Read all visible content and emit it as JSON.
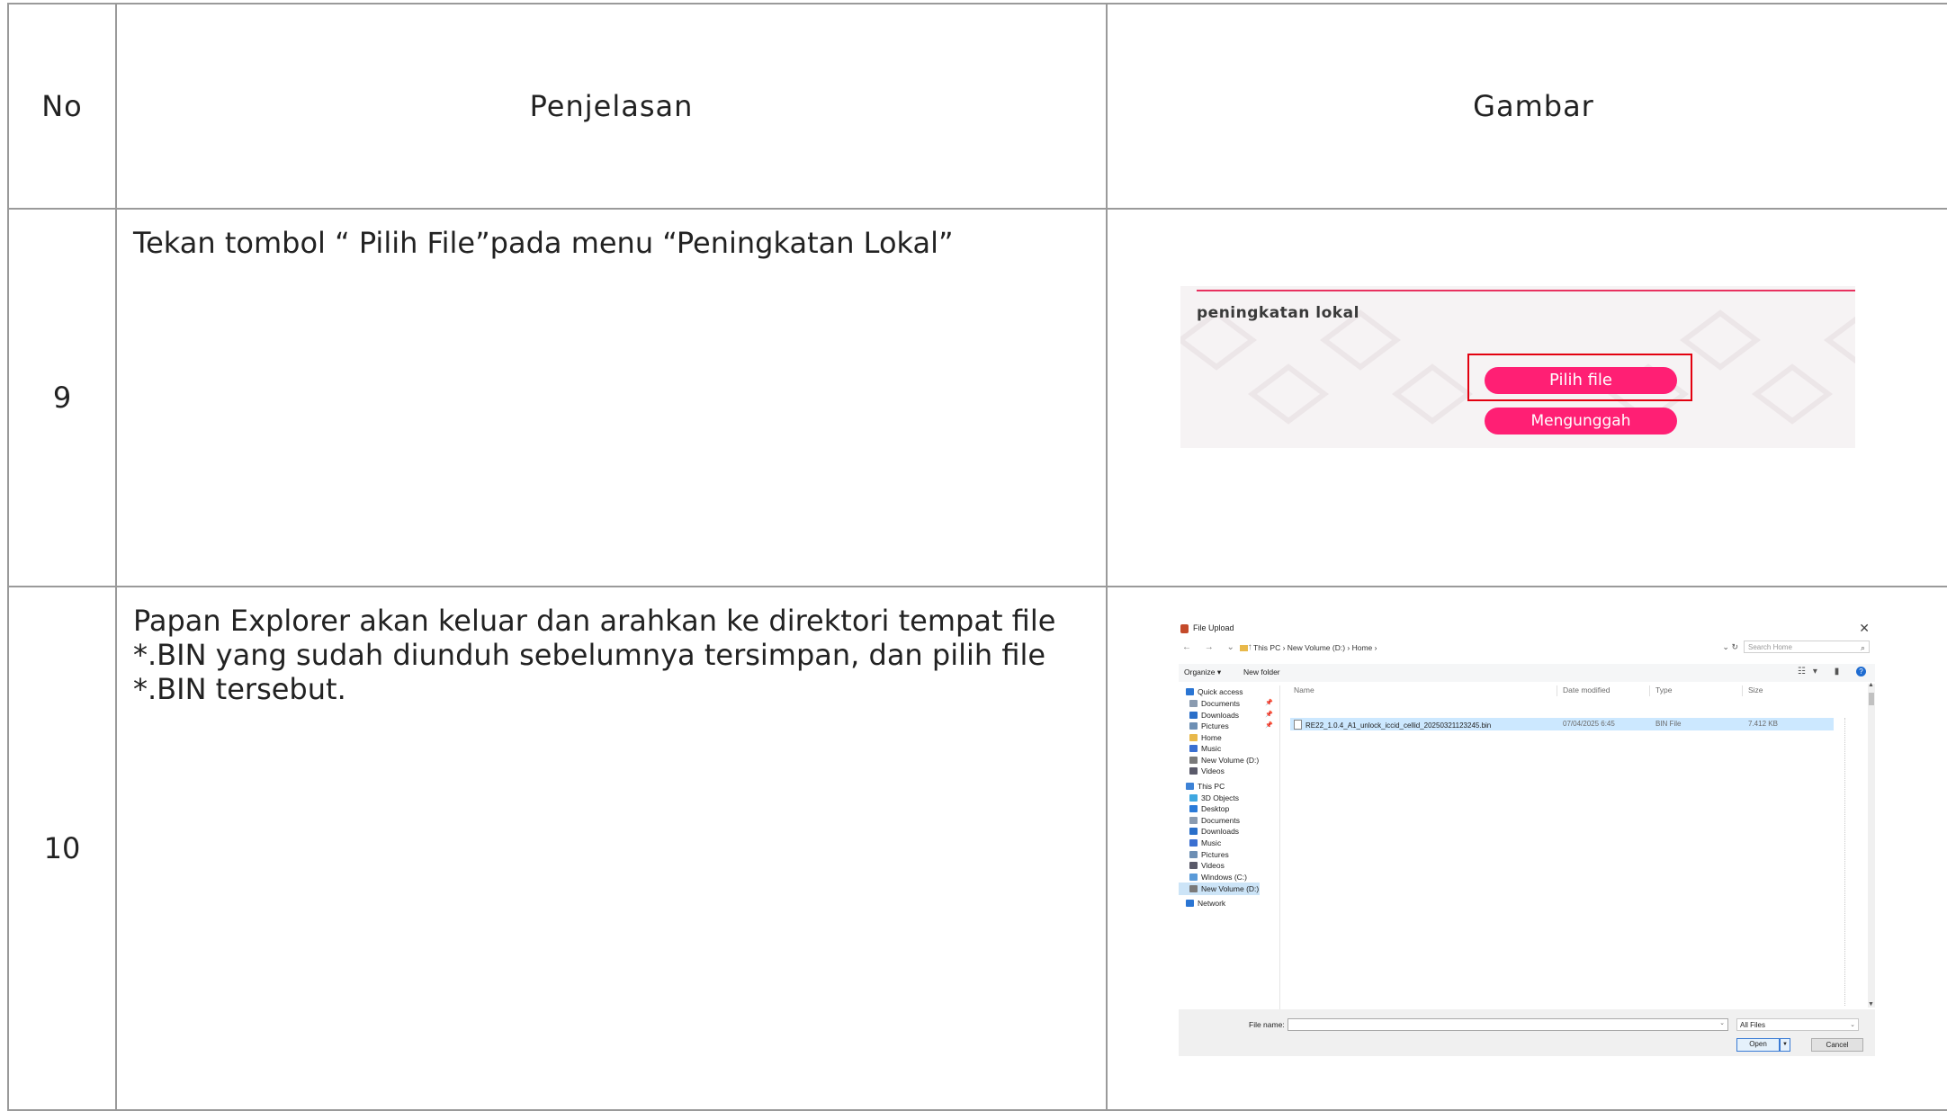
{
  "table": {
    "headers": {
      "no": "No",
      "penjelasan": "Penjelasan",
      "gambar": "Gambar"
    },
    "rows": [
      {
        "no": "9",
        "penjelasan": "Tekan tombol “ Pilih File”pada menu “Peningkatan Lokal”"
      },
      {
        "no": "10",
        "penjelasan": "Papan Explorer akan keluar dan arahkan ke direktori tempat file *.BIN yang sudah diunduh sebelumnya tersimpan, dan pilih file *.BIN tersebut."
      }
    ]
  },
  "shot_upgrade": {
    "title": "peningkatan lokal",
    "choose_file_label": "Pilih file",
    "upload_label": "Mengunggah",
    "accent": "#ff1f74",
    "highlight": "#e3000f"
  },
  "shot_dialog": {
    "title": "File Upload",
    "close": "✕",
    "nav_arrows": "← → ⌄ ↑",
    "breadcrumb": "This PC  ›  New Volume (D:)  ›  Home  ›",
    "search_placeholder": "Search Home",
    "organize": "Organize ▾",
    "new_folder": "New folder",
    "columns": {
      "name": "Name",
      "date": "Date modified",
      "type": "Type",
      "size": "Size"
    },
    "sidebar": [
      {
        "label": "Quick access",
        "icon": "star-icon",
        "color": "#2a75d3"
      },
      {
        "label": "Documents",
        "icon": "documents-icon",
        "color": "#8a9bb0"
      },
      {
        "label": "Downloads",
        "icon": "downloads-icon",
        "color": "#2a6fc9"
      },
      {
        "label": "Pictures",
        "icon": "pictures-icon",
        "color": "#6d8fb4"
      },
      {
        "label": "Home",
        "icon": "folder-icon",
        "color": "#e8b84a"
      },
      {
        "label": "Music",
        "icon": "music-icon",
        "color": "#3a6fd1"
      },
      {
        "label": "New Volume (D:)",
        "icon": "drive-icon",
        "color": "#7a7a7a"
      },
      {
        "label": "Videos",
        "icon": "videos-icon",
        "color": "#5a5a6a"
      },
      {
        "label": "This PC",
        "icon": "pc-icon",
        "color": "#3d82d6"
      },
      {
        "label": "3D Objects",
        "icon": "3d-objects-icon",
        "color": "#3fa7e0"
      },
      {
        "label": "Desktop",
        "icon": "desktop-icon",
        "color": "#2a7ad8"
      },
      {
        "label": "Documents",
        "icon": "documents-icon",
        "color": "#8a9bb0"
      },
      {
        "label": "Downloads",
        "icon": "downloads-icon",
        "color": "#2a6fc9"
      },
      {
        "label": "Music",
        "icon": "music-icon",
        "color": "#3a6fd1"
      },
      {
        "label": "Pictures",
        "icon": "pictures-icon",
        "color": "#6d8fb4"
      },
      {
        "label": "Videos",
        "icon": "videos-icon",
        "color": "#5a5a6a"
      },
      {
        "label": "Windows  (C:)",
        "icon": "drive-c-icon",
        "color": "#5a9ad8"
      },
      {
        "label": "New Volume (D:)",
        "icon": "drive-icon",
        "color": "#7a7a7a",
        "selected": true
      },
      {
        "label": "Network",
        "icon": "network-icon",
        "color": "#2a75d3"
      }
    ],
    "file": {
      "name": "RE22_1.0.4_A1_unlock_iccid_cellid_20250321123245.bin",
      "date": "07/04/2025 6:45",
      "type": "BIN File",
      "size": "7.412 KB"
    },
    "file_name_label": "File name:",
    "file_name_value": "",
    "filter": "All Files",
    "open": "Open",
    "cancel": "Cancel"
  }
}
